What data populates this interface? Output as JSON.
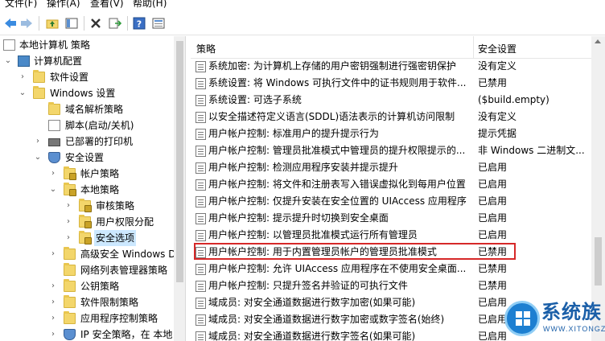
{
  "menu": [
    "文件(F)",
    "操作(A)",
    "查看(V)",
    "帮助(H)"
  ],
  "toolbar": {
    "icons": [
      "back-arrow-icon",
      "forward-arrow-icon",
      "folder-up-icon",
      "show-hide-tree-icon",
      "delete-icon",
      "export-list-icon",
      "help-icon",
      "properties-icon"
    ]
  },
  "tree": {
    "items": [
      {
        "label": "本地计算机 策略"
      },
      {
        "label": "计算机配置"
      },
      {
        "label": "软件设置"
      },
      {
        "label": "Windows 设置"
      },
      {
        "label": "域名解析策略"
      },
      {
        "label": "脚本(启动/关机)"
      },
      {
        "label": "已部署的打印机"
      },
      {
        "label": "安全设置"
      },
      {
        "label": "帐户策略"
      },
      {
        "label": "本地策略"
      },
      {
        "label": "审核策略"
      },
      {
        "label": "用户权限分配"
      },
      {
        "label": "安全选项"
      },
      {
        "label": "高级安全 Windows D"
      },
      {
        "label": "网络列表管理器策略"
      },
      {
        "label": "公钥策略"
      },
      {
        "label": "软件限制策略"
      },
      {
        "label": "应用程序控制策略"
      },
      {
        "label": "IP 安全策略，在 本地"
      }
    ]
  },
  "policy_list": {
    "headers": {
      "policy": "策略",
      "setting": "安全设置"
    },
    "rows": [
      {
        "name": "系统加密: 为计算机上存储的用户密钥强制进行强密钥保护",
        "value": "没有定义"
      },
      {
        "name": "系统设置: 将 Windows 可执行文件中的证书规则用于软件...",
        "value": "已禁用"
      },
      {
        "name": "系统设置: 可选子系统",
        "value": "($build.empty)"
      },
      {
        "name": "以安全描述符定义语言(SDDL)语法表示的计算机访问限制",
        "value": "没有定义"
      },
      {
        "name": "用户帐户控制: 标准用户的提升提示行为",
        "value": "提示凭据"
      },
      {
        "name": "用户帐户控制: 管理员批准模式中管理员的提升权限提示的...",
        "value": "非 Windows 二进制文..."
      },
      {
        "name": "用户帐户控制: 检测应用程序安装并提示提升",
        "value": "已启用"
      },
      {
        "name": "用户帐户控制: 将文件和注册表写入错误虚拟化到每用户位置",
        "value": "已启用"
      },
      {
        "name": "用户帐户控制: 仅提升安装在安全位置的 UIAccess 应用程序",
        "value": "已启用"
      },
      {
        "name": "用户帐户控制: 提示提升时切换到安全桌面",
        "value": "已启用"
      },
      {
        "name": "用户帐户控制: 以管理员批准模式运行所有管理员",
        "value": "已启用"
      },
      {
        "name": "用户帐户控制: 用于内置管理员帐户的管理员批准模式",
        "value": "已禁用"
      },
      {
        "name": "用户帐户控制: 允许 UIAccess 应用程序在不使用安全桌面...",
        "value": "已禁用"
      },
      {
        "name": "用户帐户控制: 只提升签名并验证的可执行文件",
        "value": "已禁用"
      },
      {
        "name": "域成员: 对安全通道数据进行数字加密(如果可能)",
        "value": "已启用"
      },
      {
        "name": "域成员: 对安全通道数据进行数字加密或数字签名(始终)",
        "value": "已启用"
      },
      {
        "name": "域成员: 对安全通道数据进行数字签名(如果可能)",
        "value": "已启用"
      }
    ]
  },
  "watermark": {
    "title": "系统族",
    "url": "WWW.XITONGZU.COM"
  },
  "colors": {
    "highlight_border": "#d62828",
    "selection": "#cce8ff"
  }
}
